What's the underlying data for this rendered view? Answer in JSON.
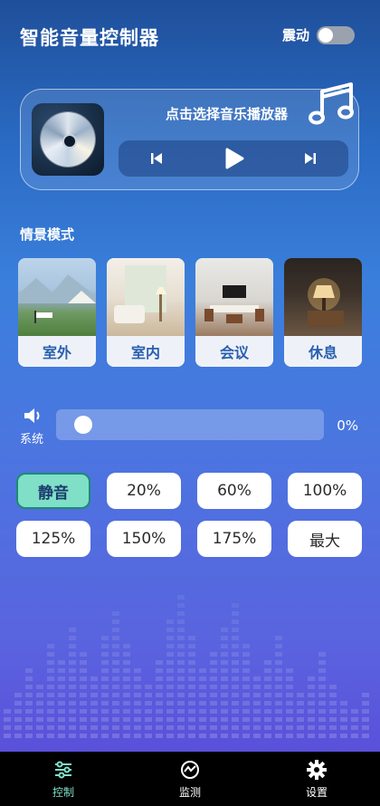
{
  "header": {
    "title": "智能音量控制器",
    "vibrate_label": "震动",
    "vibrate_on": false
  },
  "player": {
    "prompt": "点击选择音乐播放器",
    "icons": {
      "prev": "skip-previous-icon",
      "play": "play-icon",
      "next": "skip-next-icon",
      "music": "music-note-icon"
    }
  },
  "scenes": {
    "title": "情景模式",
    "items": [
      {
        "label": "室外"
      },
      {
        "label": "室内"
      },
      {
        "label": "会议"
      },
      {
        "label": "休息"
      }
    ]
  },
  "system_volume": {
    "label": "系统",
    "percent_text": "0%",
    "level": 0
  },
  "presets": [
    {
      "label": "静音",
      "active": true
    },
    {
      "label": "20%"
    },
    {
      "label": "60%"
    },
    {
      "label": "100%"
    },
    {
      "label": "125%"
    },
    {
      "label": "150%"
    },
    {
      "label": "175%"
    },
    {
      "label": "最大"
    }
  ],
  "nav": [
    {
      "label": "控制",
      "icon": "sliders-icon",
      "active": true
    },
    {
      "label": "监测",
      "icon": "monitor-icon"
    },
    {
      "label": "设置",
      "icon": "gear-icon"
    }
  ],
  "colors": {
    "accent": "#7fe0c7",
    "active_nav": "#7fe0c7",
    "label_blue": "#2a5fb0"
  }
}
